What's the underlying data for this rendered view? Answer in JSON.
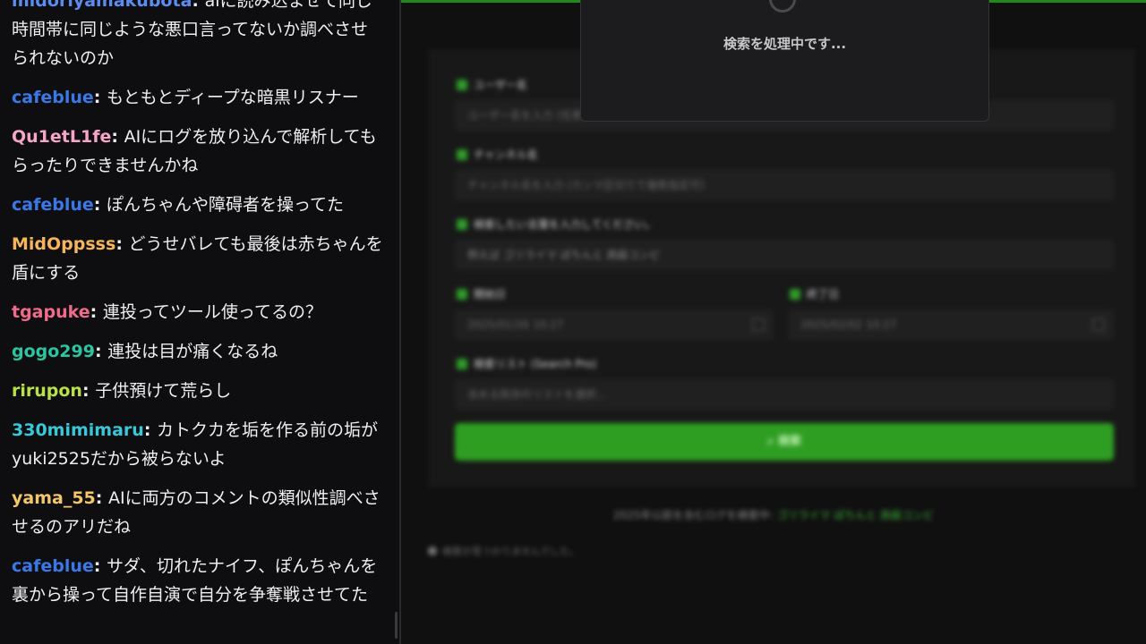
{
  "chat": {
    "messages": [
      {
        "user": "midoriyamakubota",
        "color": "#5c8cf0",
        "text": "aiに読み込ませて同じ時間帯に同じような悪口言ってないか調べさせられないのか"
      },
      {
        "user": "cafeblue",
        "color": "#3b78e7",
        "text": "もともとディープな暗黒リスナー"
      },
      {
        "user": "Qu1etL1fe",
        "color": "#f5a6c8",
        "text": "AIにログを放り込んで解析してもらったりできませんかね"
      },
      {
        "user": "cafeblue",
        "color": "#3b78e7",
        "text": "ぽんちゃんや障碍者を操ってた"
      },
      {
        "user": "MidOppsss",
        "color": "#f7b55b",
        "text": "どうせバレても最後は赤ちゃんを盾にする"
      },
      {
        "user": "tgapuke",
        "color": "#f06a8a",
        "text": "連投ってツール使ってるの？"
      },
      {
        "user": "gogo299",
        "color": "#2bc6a0",
        "text": "連投は目が痛くなるね"
      },
      {
        "user": "rirupon",
        "color": "#b7e04a",
        "text": "子供預けて荒らし"
      },
      {
        "user": "330mimimaru",
        "color": "#37c9d8",
        "text": "カトクカを垢を作る前の垢がyuki2525だから被らないよ"
      },
      {
        "user": "yama_55",
        "color": "#f4c66a",
        "text": "AIに両方のコメントの類似性調べさせるのアリだね"
      },
      {
        "user": "cafeblue",
        "color": "#3b78e7",
        "text": "サダ、切れたナイフ、ぽんちゃんを裏から操って自作自演で自分を争奪戦させてた"
      }
    ]
  },
  "app": {
    "labels": {
      "username": "ユーザー名",
      "channel": "チャンネル名",
      "keyword": "検索したい言葉を入力してください。",
      "start_date": "開始日",
      "end_date": "終了日",
      "list": "検索リスト (Search Pro)"
    },
    "inputs": {
      "username_placeholder": "ユーザー名を入力 (任意)",
      "channel_placeholder": "チャンネル名を入力 (カンマ区切りで複数指定可)",
      "keyword_value": "例えば ゴリライマ ぽちんと 高級コンビ",
      "start_value": "2025/01/26 10:27",
      "end_value": "2025/02/02 10:27",
      "list_placeholder": "含める既存のリストを選択..."
    },
    "search_button": "検索",
    "footer": {
      "prefix": "2025年以前を含むログを検索中: ",
      "link": "ゴリライマ ぽちんと 高級コンビ"
    },
    "status": "検索が見つかりませんでした。",
    "accent": "#2e9e22"
  },
  "modal": {
    "text": "検索を処理中です..."
  }
}
